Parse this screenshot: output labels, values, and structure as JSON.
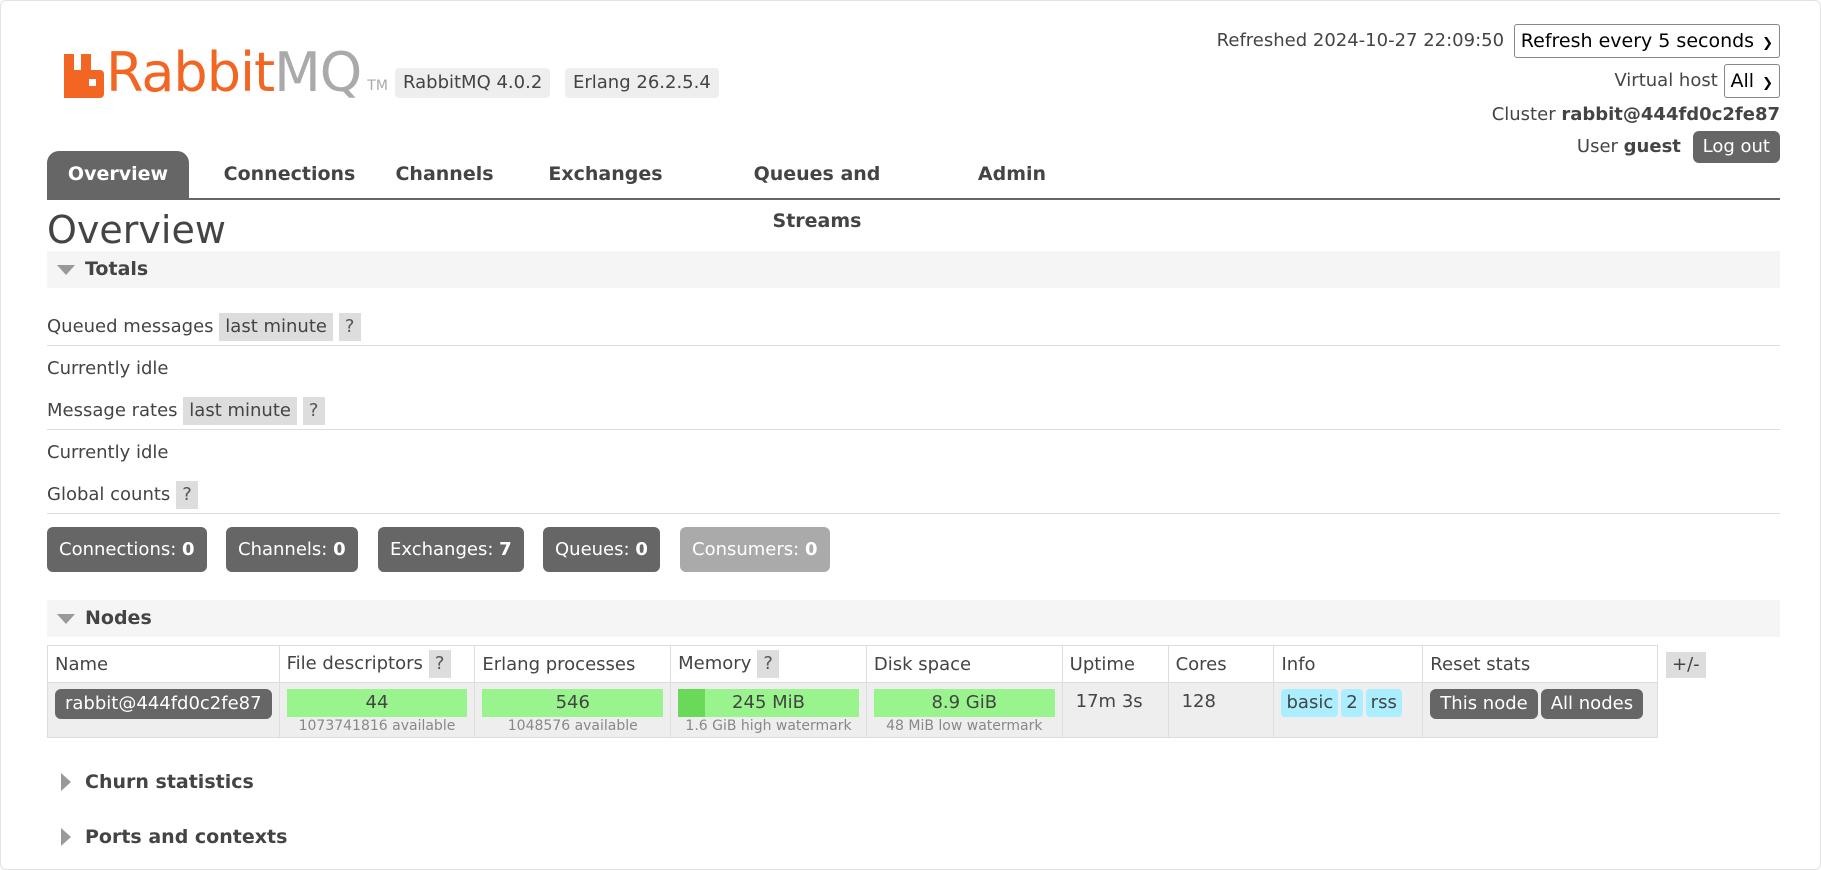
{
  "header": {
    "logo_text": "Rabbit",
    "logo_text_mq": "MQ",
    "logo_tm": "TM",
    "version_rabbitmq": "RabbitMQ 4.0.2",
    "version_erlang": "Erlang 26.2.5.4",
    "refreshed": "Refreshed 2024-10-27 22:09:50",
    "refresh_option": "Refresh every 5 seconds",
    "vhost_label": "Virtual host",
    "vhost_value": "All",
    "cluster_label": "Cluster",
    "cluster_value": "rabbit@444fd0c2fe87",
    "user_label": "User",
    "user_value": "guest",
    "logout": "Log out"
  },
  "tabs": [
    "Overview",
    "Connections",
    "Channels",
    "Exchanges",
    "Queues and Streams",
    "Admin"
  ],
  "page_title": "Overview",
  "totals": {
    "title": "Totals",
    "queued_label": "Queued messages",
    "queued_range": "last minute",
    "queued_idle": "Currently idle",
    "rates_label": "Message rates",
    "rates_range": "last minute",
    "rates_idle": "Currently idle",
    "global_label": "Global counts",
    "help": "?",
    "counts": [
      {
        "label": "Connections:",
        "value": "0"
      },
      {
        "label": "Channels:",
        "value": "0"
      },
      {
        "label": "Exchanges:",
        "value": "7"
      },
      {
        "label": "Queues:",
        "value": "0"
      },
      {
        "label": "Consumers:",
        "value": "0"
      }
    ]
  },
  "nodes": {
    "title": "Nodes",
    "plusminus": "+/-",
    "columns": [
      "Name",
      "File descriptors",
      "Erlang processes",
      "Memory",
      "Disk space",
      "Uptime",
      "Cores",
      "Info",
      "Reset stats"
    ],
    "row": {
      "name": "rabbit@444fd0c2fe87",
      "fd": "44",
      "fd_sub": "1073741816 available",
      "procs": "546",
      "procs_sub": "1048576 available",
      "memory": "245 MiB",
      "memory_sub": "1.6 GiB high watermark",
      "memory_fraction": 0.15,
      "disk": "8.9 GiB",
      "disk_sub": "48 MiB low watermark",
      "uptime": "17m 3s",
      "cores": "128",
      "info_tags": [
        "basic",
        "2",
        "rss"
      ],
      "reset_this": "This node",
      "reset_all": "All nodes"
    }
  },
  "collapsed_sections": [
    "Churn statistics",
    "Ports and contexts"
  ],
  "colors": {
    "brand": "#f26522",
    "tab_active": "#666666",
    "bar_ok": "#99f48e",
    "info_tag": "#aaeeff"
  }
}
